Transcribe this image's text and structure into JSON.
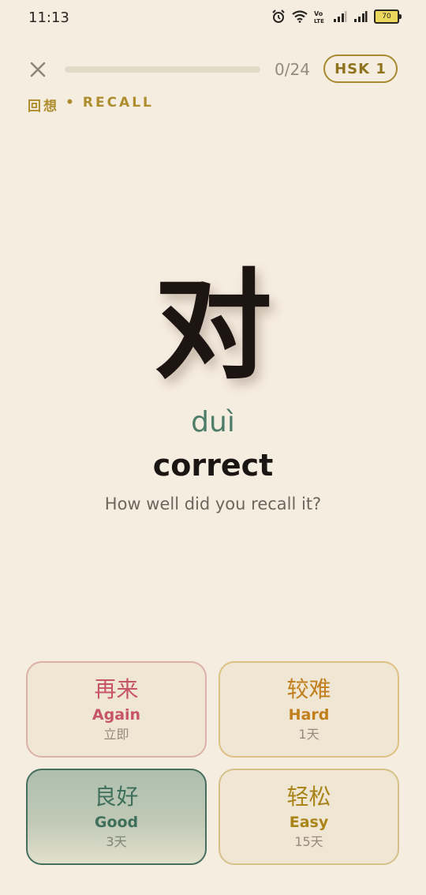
{
  "status_bar": {
    "time": "11:13",
    "battery": "70",
    "icons": [
      "alarm-icon",
      "wifi-icon",
      "volte-icon",
      "signal-icon",
      "signal-icon",
      "battery-icon"
    ]
  },
  "header": {
    "close_icon": "close-icon",
    "progress": {
      "text": "0/24",
      "current": 0,
      "total": 24,
      "fraction": 0.0
    },
    "level_badge": "HSK 1",
    "mode_zh": "回想",
    "mode_dot": "•",
    "mode_en": "RECALL"
  },
  "card": {
    "hanzi": "对",
    "pinyin": "duì",
    "meaning": "correct",
    "prompt": "How well did you recall it?"
  },
  "grades": [
    {
      "zh": "再来",
      "en": "Again",
      "interval": "立即",
      "color": "#c75568"
    },
    {
      "zh": "较难",
      "en": "Hard",
      "interval": "1天",
      "color": "#c07f1c"
    },
    {
      "zh": "良好",
      "en": "Good",
      "interval": "3天",
      "color": "#3f705c"
    },
    {
      "zh": "轻松",
      "en": "Easy",
      "interval": "15天",
      "color": "#a98518"
    }
  ],
  "colors": {
    "background": "#f6ede1",
    "accent_gold": "#ad8d2e",
    "pinyin_green": "#4d7d69"
  }
}
